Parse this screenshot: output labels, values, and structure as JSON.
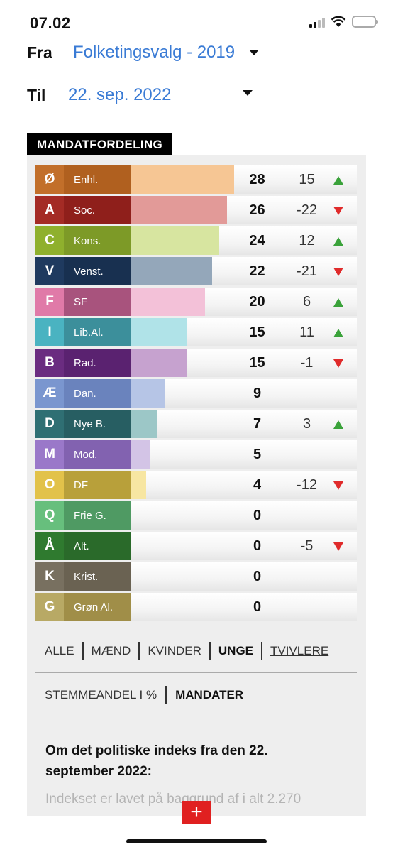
{
  "status": {
    "time": "07.02"
  },
  "from": {
    "label": "Fra",
    "value": "Folketingsvalg - 2019"
  },
  "to": {
    "label": "Til",
    "value": "22. sep. 2022"
  },
  "section_title": "MANDATFORDELING",
  "max_seats": 28,
  "parties": [
    {
      "letter": "Ø",
      "name": "Enhl.",
      "seats": 28,
      "change": "15",
      "trend": "up",
      "dark": "#c26f2a",
      "name_bg": "#b0601f",
      "light": "#f6c694"
    },
    {
      "letter": "A",
      "name": "Soc.",
      "seats": 26,
      "change": "-22",
      "trend": "down",
      "dark": "#a42b25",
      "name_bg": "#8f1f1b",
      "light": "#e29a98"
    },
    {
      "letter": "C",
      "name": "Kons.",
      "seats": 24,
      "change": "12",
      "trend": "up",
      "dark": "#8fb02d",
      "name_bg": "#7d9a27",
      "light": "#d7e5a0"
    },
    {
      "letter": "V",
      "name": "Venst.",
      "seats": 22,
      "change": "-21",
      "trend": "down",
      "dark": "#1f3a5f",
      "name_bg": "#183050",
      "light": "#94a7ba"
    },
    {
      "letter": "F",
      "name": "SF",
      "seats": 20,
      "change": "6",
      "trend": "up",
      "dark": "#e07aa8",
      "name_bg": "#a8537d",
      "light": "#f3c1d8"
    },
    {
      "letter": "I",
      "name": "Lib.Al.",
      "seats": 15,
      "change": "11",
      "trend": "up",
      "dark": "#4ab3c1",
      "name_bg": "#3c8f9b",
      "light": "#b0e3e8"
    },
    {
      "letter": "B",
      "name": "Rad.",
      "seats": 15,
      "change": "-1",
      "trend": "down",
      "dark": "#6a2c80",
      "name_bg": "#5a2270",
      "light": "#c6a2cf"
    },
    {
      "letter": "Æ",
      "name": "Dan.",
      "seats": 9,
      "change": "",
      "trend": "",
      "dark": "#7a96cf",
      "name_bg": "#6a83bd",
      "light": "#b6c5e6"
    },
    {
      "letter": "D",
      "name": "Nye B.",
      "seats": 7,
      "change": "3",
      "trend": "up",
      "dark": "#2f6f73",
      "name_bg": "#275e62",
      "light": "#9cc7c7"
    },
    {
      "letter": "M",
      "name": "Mod.",
      "seats": 5,
      "change": "",
      "trend": "",
      "dark": "#9a78c9",
      "name_bg": "#8262b0",
      "light": "#d3c4e6"
    },
    {
      "letter": "O",
      "name": "DF",
      "seats": 4,
      "change": "-12",
      "trend": "down",
      "dark": "#e2c24a",
      "name_bg": "#b8a03a",
      "light": "#f7e6a2"
    },
    {
      "letter": "Q",
      "name": "Frie G.",
      "seats": 0,
      "change": "",
      "trend": "",
      "dark": "#67bf7d",
      "name_bg": "#4f9a63",
      "light": "#c8e8d0"
    },
    {
      "letter": "Å",
      "name": "Alt.",
      "seats": 0,
      "change": "-5",
      "trend": "down",
      "dark": "#2f7a2f",
      "name_bg": "#2a6a2a",
      "light": "#a8cfa8"
    },
    {
      "letter": "K",
      "name": "Krist.",
      "seats": 0,
      "change": "",
      "trend": "",
      "dark": "#787060",
      "name_bg": "#6a6252",
      "light": "#cfc8bb"
    },
    {
      "letter": "G",
      "name": "Grøn Al.",
      "seats": 0,
      "change": "",
      "trend": "",
      "dark": "#b8a965",
      "name_bg": "#a08e48",
      "light": "#e3dbb5"
    }
  ],
  "filters": [
    "ALLE",
    "MÆND",
    "KVINDER",
    "UNGE",
    "TVIVLERE"
  ],
  "active_filter": "UNGE",
  "modes": [
    "STEMMEANDEL I %",
    "MANDATER"
  ],
  "active_mode": "MANDATER",
  "about": {
    "title": "Om det politiske indeks fra den 22. september 2022:",
    "text": "Indekset er lavet på baggrund af i alt 2.270"
  },
  "plus_label": "+"
}
